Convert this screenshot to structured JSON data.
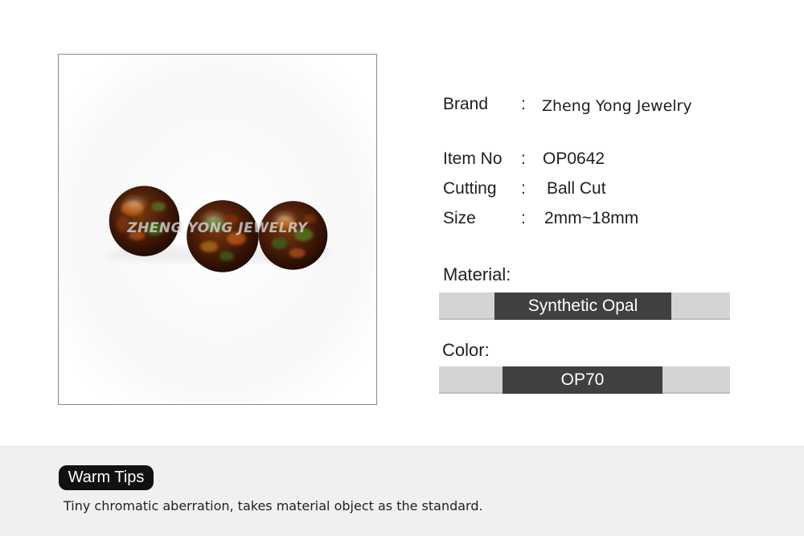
{
  "product_image": {
    "watermark": "ZHENG YONG JEWELRY",
    "subject": "three-opal-balls"
  },
  "specs": {
    "brand": {
      "label": "Brand",
      "colon": ":",
      "value": "Zheng Yong Jewelry"
    },
    "item_no": {
      "label": "Item No",
      "colon": ":",
      "value": "OP0642"
    },
    "cutting": {
      "label": "Cutting",
      "colon": ":",
      "value": "Ball Cut"
    },
    "size": {
      "label": "Size",
      "colon": ":",
      "value": "2mm~18mm"
    }
  },
  "material": {
    "label": "Material:",
    "value": "Synthetic Opal"
  },
  "color": {
    "label": "Color:",
    "value": "OP70"
  },
  "tips": {
    "badge": "Warm Tips",
    "text": "Tiny chromatic aberration, takes material object as the standard."
  },
  "colors": {
    "bar_track": "#d4d4d4",
    "bar_fill": "#404040",
    "tips_background": "#f0f0f2",
    "badge_background": "#111111"
  }
}
